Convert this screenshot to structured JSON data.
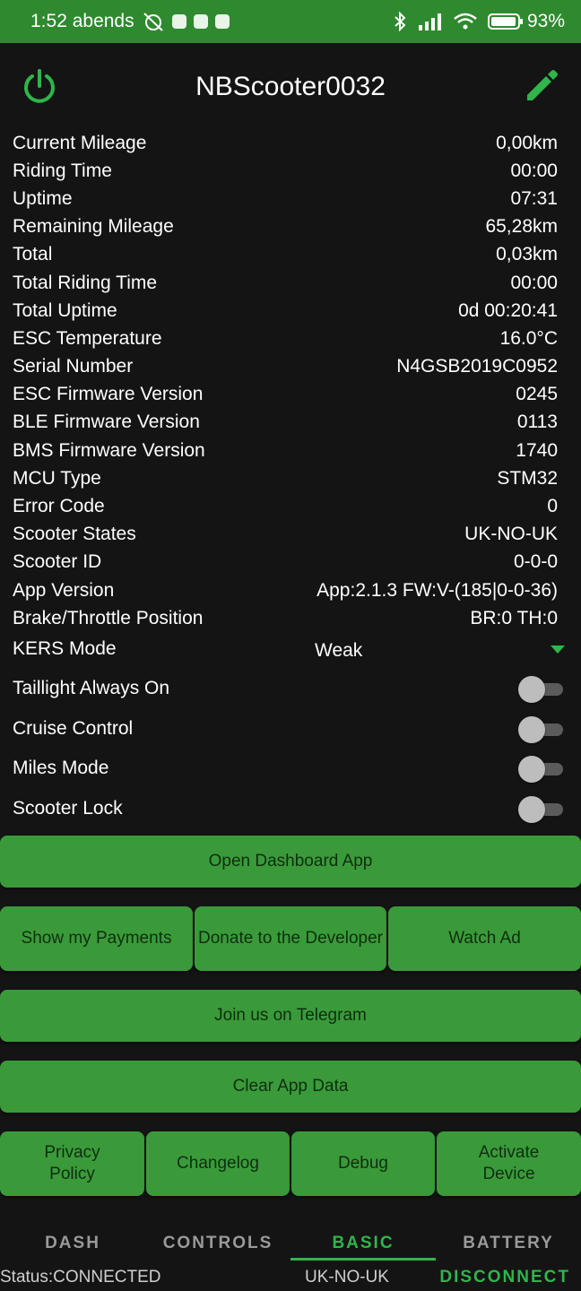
{
  "status_bar": {
    "time": "1:52 abends",
    "battery": "93%"
  },
  "header": {
    "title": "NBScooter0032",
    "power_icon": "power-icon",
    "edit_icon": "pencil-icon"
  },
  "info_rows": [
    {
      "label": "Current Mileage",
      "value": "0,00km"
    },
    {
      "label": "Riding Time",
      "value": "00:00"
    },
    {
      "label": "Uptime",
      "value": "07:31"
    },
    {
      "label": "Remaining Mileage",
      "value": "65,28km"
    },
    {
      "label": "Total",
      "value": "0,03km"
    },
    {
      "label": "Total Riding Time",
      "value": "00:00"
    },
    {
      "label": "Total Uptime",
      "value": "0d 00:20:41"
    },
    {
      "label": "ESC Temperature",
      "value": "16.0°C"
    },
    {
      "label": "Serial Number",
      "value": "N4GSB2019C0952"
    },
    {
      "label": "ESC Firmware Version",
      "value": "0245"
    },
    {
      "label": "BLE Firmware Version",
      "value": "0113"
    },
    {
      "label": "BMS Firmware Version",
      "value": "1740"
    },
    {
      "label": "MCU Type",
      "value": "STM32"
    },
    {
      "label": "Error Code",
      "value": "0"
    },
    {
      "label": "Scooter States",
      "value": "UK-NO-UK"
    },
    {
      "label": "Scooter ID",
      "value": "0-0-0"
    },
    {
      "label": "App Version",
      "value": "App:2.1.3 FW:V-(185|0-0-36)"
    },
    {
      "label": "Brake/Throttle Position",
      "value": "BR:0 TH:0"
    }
  ],
  "kers": {
    "label": "KERS Mode",
    "selected": "Weak"
  },
  "toggles": [
    {
      "label": "Taillight Always On",
      "on": false
    },
    {
      "label": "Cruise Control",
      "on": false
    },
    {
      "label": "Miles Mode",
      "on": false
    },
    {
      "label": "Scooter Lock",
      "on": false
    }
  ],
  "buttons": {
    "open_dashboard": "Open Dashboard App",
    "show_payments": "Show my Payments",
    "donate": "Donate to the Developer",
    "watch_ad": "Watch Ad",
    "telegram": "Join us on Telegram",
    "clear_data": "Clear App Data",
    "privacy": "Privacy Policy",
    "changelog": "Changelog",
    "debug": "Debug",
    "activate": "Activate Device"
  },
  "tabs": [
    {
      "label": "DASH",
      "active": false
    },
    {
      "label": "CONTROLS",
      "active": false
    },
    {
      "label": "BASIC",
      "active": true
    },
    {
      "label": "BATTERY",
      "active": false
    }
  ],
  "footer": {
    "status": "Status:CONNECTED",
    "state": "UK-NO-UK",
    "disconnect": "DISCONNECT"
  },
  "colors": {
    "accent": "#2fb54a",
    "button": "#3a9a3a",
    "background": "#141414"
  }
}
